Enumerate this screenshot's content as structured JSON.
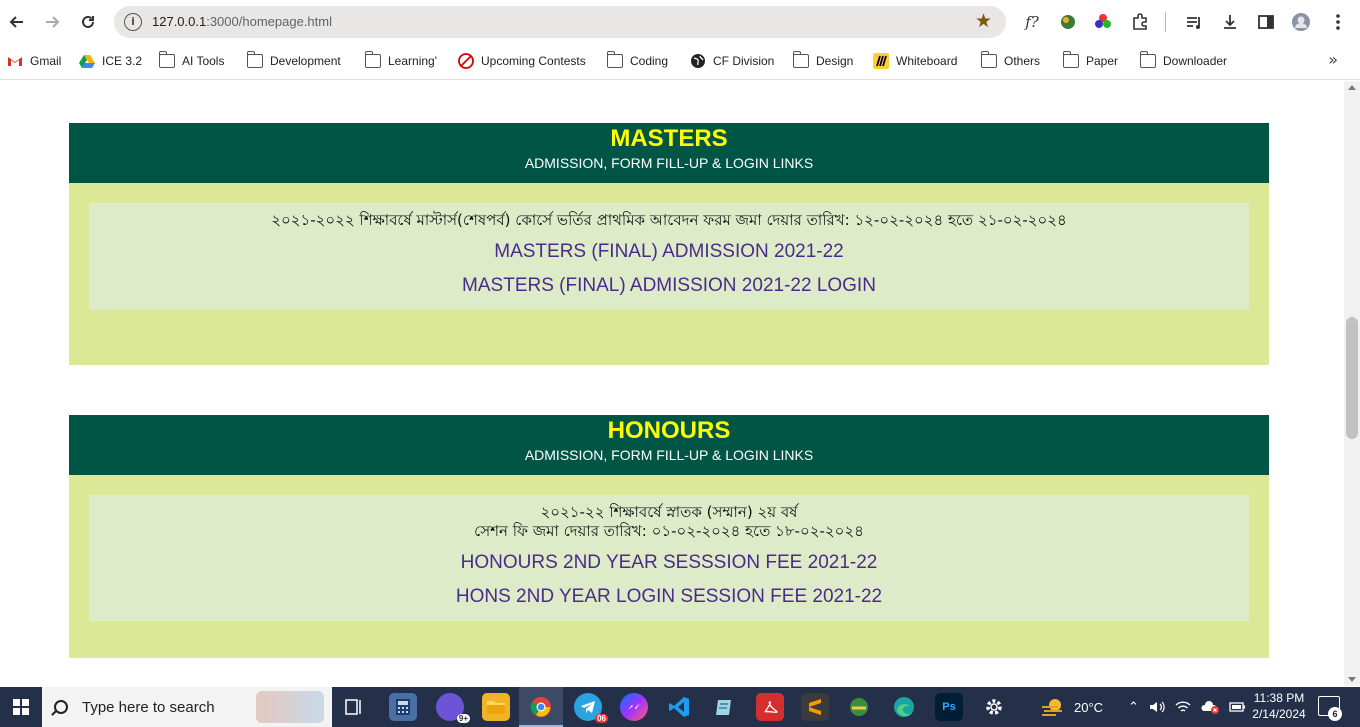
{
  "browser": {
    "url_host": "127.0.0.1",
    "url_path": ":3000/homepage.html",
    "bookmarks": [
      {
        "label": "Gmail",
        "icon": "gmail-icon"
      },
      {
        "label": "ICE 3.2",
        "icon": "drive-icon"
      },
      {
        "label": "AI Tools",
        "icon": "folder-icon"
      },
      {
        "label": "Development",
        "icon": "folder-icon"
      },
      {
        "label": "Learning'",
        "icon": "folder-icon"
      },
      {
        "label": "Upcoming Contests",
        "icon": "contest-icon"
      },
      {
        "label": "Coding",
        "icon": "folder-icon"
      },
      {
        "label": "CF Division",
        "icon": "globe-icon"
      },
      {
        "label": "Design",
        "icon": "folder-icon"
      },
      {
        "label": "Whiteboard",
        "icon": "miro-icon"
      },
      {
        "label": "Others",
        "icon": "folder-icon"
      },
      {
        "label": "Paper",
        "icon": "folder-icon"
      },
      {
        "label": "Downloader",
        "icon": "folder-icon"
      }
    ]
  },
  "masters": {
    "title": "MASTERS",
    "subtitle": "ADMISSION, FORM FILL-UP & LOGIN LINKS",
    "notice": "২০২১-২০২২ শিক্ষাবর্ষে মাস্টার্স(শেষপর্ব) কোর্সে ভর্তির প্রাথমিক আবেদন ফরম জমা দেয়ার তারিখ: ১২-০২-২০২৪ হতে ২১-০২-২০২৪",
    "links": [
      "MASTERS (FINAL) ADMISSION 2021-22",
      "MASTERS (FINAL) ADMISSION 2021-22 LOGIN"
    ]
  },
  "honours": {
    "title": "HONOURS",
    "subtitle": "ADMISSION, FORM FILL-UP & LOGIN LINKS",
    "notice_line1": "২০২১-২২ শিক্ষাবর্ষে স্নাতক (সম্মান) ২য় বর্ষ",
    "notice_line2": "সেশন ফি জমা দেয়ার তারিখ: ০১-০২-২০২৪ হতে ১৮-০২-২০২৪",
    "links": [
      "HONOURS 2ND YEAR SESSSION FEE 2021-22",
      "HONS 2ND YEAR LOGIN SESSION FEE 2021-22"
    ]
  },
  "taskbar": {
    "search_placeholder": "Type here to search",
    "weather": "20°C",
    "time": "11:38 PM",
    "date": "2/14/2024",
    "notification_count": "6",
    "chrome_badge": "9+",
    "telegram_badge": "06"
  },
  "colors": {
    "section_header": "#005544",
    "section_title": "#ffff00",
    "section_body": "#dbe996",
    "card_bg": "#deebc9",
    "link": "#4a2a8a"
  }
}
